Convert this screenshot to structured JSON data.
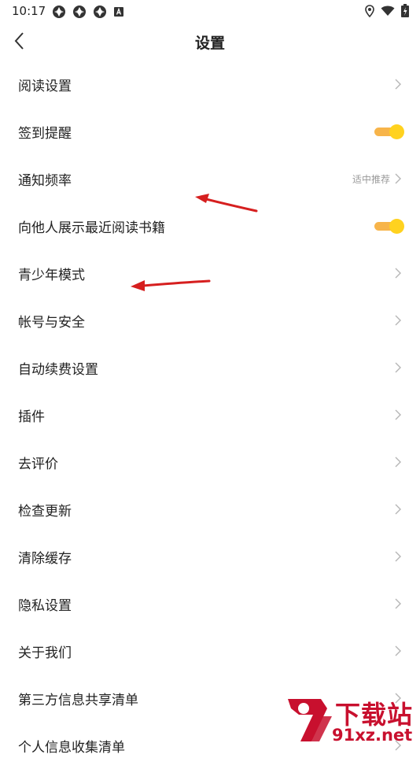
{
  "status_bar": {
    "time": "10:17"
  },
  "header": {
    "title": "设置"
  },
  "settings": [
    {
      "label": "阅读设置",
      "control": "chevron"
    },
    {
      "label": "签到提醒",
      "control": "toggle",
      "on": true
    },
    {
      "label": "通知频率",
      "control": "chevron",
      "value": "适中推荐"
    },
    {
      "label": "向他人展示最近阅读书籍",
      "control": "toggle",
      "on": true
    },
    {
      "label": "青少年模式",
      "control": "chevron"
    },
    {
      "label": "帐号与安全",
      "control": "chevron"
    },
    {
      "label": "自动续费设置",
      "control": "chevron"
    },
    {
      "label": "插件",
      "control": "chevron"
    },
    {
      "label": "去评价",
      "control": "chevron"
    },
    {
      "label": "检查更新",
      "control": "chevron"
    },
    {
      "label": "清除缓存",
      "control": "chevron"
    },
    {
      "label": "隐私设置",
      "control": "chevron"
    },
    {
      "label": "关于我们",
      "control": "chevron"
    },
    {
      "label": "第三方信息共享清单",
      "control": "chevron"
    },
    {
      "label": "个人信息收集清单",
      "control": "chevron"
    }
  ],
  "watermark": {
    "top_text": "下载站",
    "bottom_text": "91xz.net"
  },
  "colors": {
    "toggle_track": "#f7b44a",
    "toggle_knob": "#ffd21f",
    "annotation_arrow": "#d61f1f"
  }
}
